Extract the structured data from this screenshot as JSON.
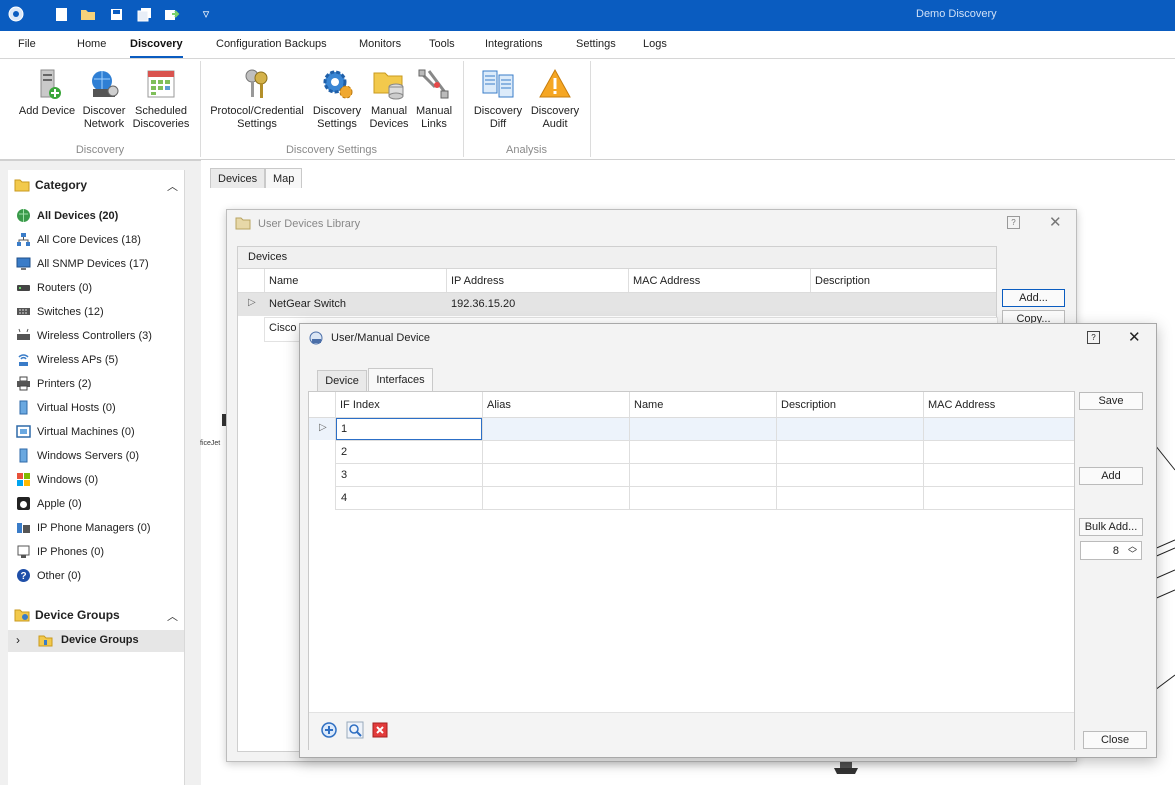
{
  "app": {
    "title": "Demo Discovery"
  },
  "menu": [
    "File",
    "Home",
    "Discovery",
    "Configuration Backups",
    "Monitors",
    "Tools",
    "Integrations",
    "Settings",
    "Logs"
  ],
  "ribbon": {
    "buttons": [
      {
        "l1": "Add Device",
        "l2": "",
        "icon": "server-add-icon"
      },
      {
        "l1": "Discover",
        "l2": "Network",
        "icon": "discover-network-icon"
      },
      {
        "l1": "Scheduled",
        "l2": "Discoveries",
        "icon": "calendar-icon"
      },
      {
        "l1": "Protocol/Credential",
        "l2": "Settings",
        "icon": "keys-icon"
      },
      {
        "l1": "Discovery",
        "l2": "Settings",
        "icon": "gear-icon"
      },
      {
        "l1": "Manual",
        "l2": "Devices",
        "icon": "folder-database-icon"
      },
      {
        "l1": "Manual",
        "l2": "Links",
        "icon": "cable-icon"
      },
      {
        "l1": "Discovery",
        "l2": "Diff",
        "icon": "diff-icon"
      },
      {
        "l1": "Discovery",
        "l2": "Audit",
        "icon": "warning-icon"
      }
    ],
    "groups": [
      "Discovery",
      "Discovery Settings",
      "Analysis"
    ]
  },
  "sidebar": {
    "category_title": "Category",
    "items": [
      "All Devices (20)",
      "All Core Devices (18)",
      "All SNMP Devices (17)",
      "Routers (0)",
      "Switches (12)",
      "Wireless Controllers (3)",
      "Wireless APs (5)",
      "Printers (2)",
      "Virtual Hosts (0)",
      "Virtual Machines (0)",
      "Windows Servers (0)",
      "Windows (0)",
      "Apple (0)",
      "IP Phone Managers (0)",
      "IP Phones (0)",
      "Other (0)"
    ],
    "groups_title": "Device Groups",
    "groups_item": "Device Groups"
  },
  "doc_tabs": [
    "Devices",
    "Map"
  ],
  "map_partial_label": "ficeJet",
  "library": {
    "title": "User Devices Library",
    "section": "Devices",
    "columns": [
      "Name",
      "IP Address",
      "MAC Address",
      "Description"
    ],
    "rows": [
      {
        "name": "NetGear Switch",
        "ip": "192.36.15.20",
        "mac": "",
        "desc": ""
      },
      {
        "name": "Cisco R",
        "ip": "",
        "mac": "",
        "desc": ""
      }
    ],
    "add_label": "Add...",
    "copy_label": "Copy..."
  },
  "manual": {
    "title": "User/Manual Device",
    "tabs": [
      "Device",
      "Interfaces"
    ],
    "columns": [
      "IF Index",
      "Alias",
      "Name",
      "Description",
      "MAC Address"
    ],
    "rows": [
      "1",
      "2",
      "3",
      "4"
    ],
    "save_label": "Save",
    "add_label": "Add",
    "bulk_label": "Bulk Add...",
    "bulk_count": "8",
    "close_label": "Close"
  }
}
